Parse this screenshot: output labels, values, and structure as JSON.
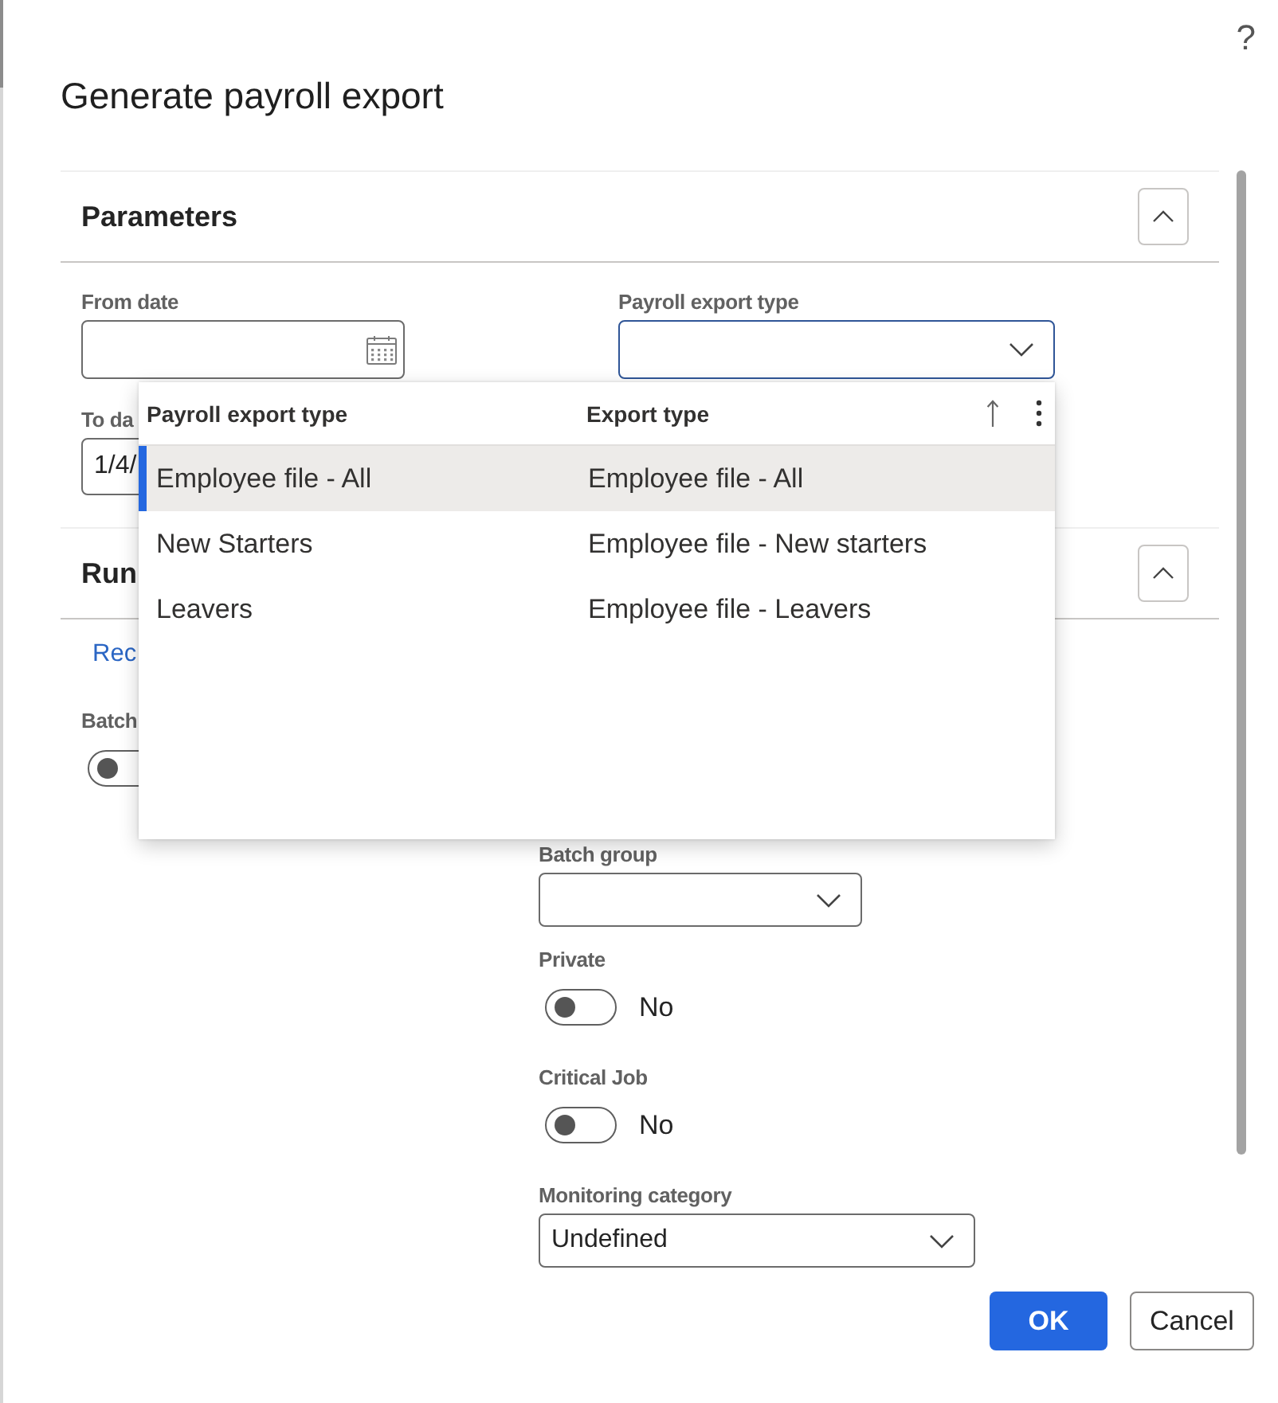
{
  "help_button": {
    "label": "?"
  },
  "title": "Generate payroll export",
  "sections": [
    {
      "title": "Parameters",
      "expanded": true,
      "fields": [
        {
          "kind": "date",
          "label": "From date"
        },
        {
          "kind": "combobox",
          "label": "Payroll export type",
          "expanded": true
        },
        {
          "kind": "date",
          "label": "To da",
          "value": "1/4/"
        }
      ]
    },
    {
      "title": "Run",
      "expanded": true,
      "link": "Rec",
      "left_fields": [
        {
          "kind": "toggle",
          "label": "Batch",
          "on": false
        }
      ],
      "right_fields": [
        {
          "kind": "combobox",
          "label": "Batch group",
          "expanded": false
        },
        {
          "kind": "toggle",
          "label": "Private",
          "on": false,
          "state_text": "No"
        },
        {
          "kind": "toggle",
          "label": "Critical Job",
          "on": false,
          "state_text": "No"
        },
        {
          "kind": "combobox",
          "label": "Monitoring category",
          "expanded": false,
          "value": "Undefined"
        }
      ]
    }
  ],
  "lookup": {
    "columns": [
      "Payroll export type",
      "Export type"
    ],
    "rows": [
      {
        "cells": [
          "Employee file - All",
          "Employee file - All"
        ],
        "selected": true
      },
      {
        "cells": [
          "New Starters",
          "Employee file - New starters"
        ],
        "selected": false
      },
      {
        "cells": [
          "Leavers",
          "Employee file - Leavers"
        ],
        "selected": false
      }
    ]
  },
  "buttons": [
    {
      "label": "OK",
      "kind": "primary"
    },
    {
      "label": "Cancel",
      "kind": "secondary"
    }
  ]
}
